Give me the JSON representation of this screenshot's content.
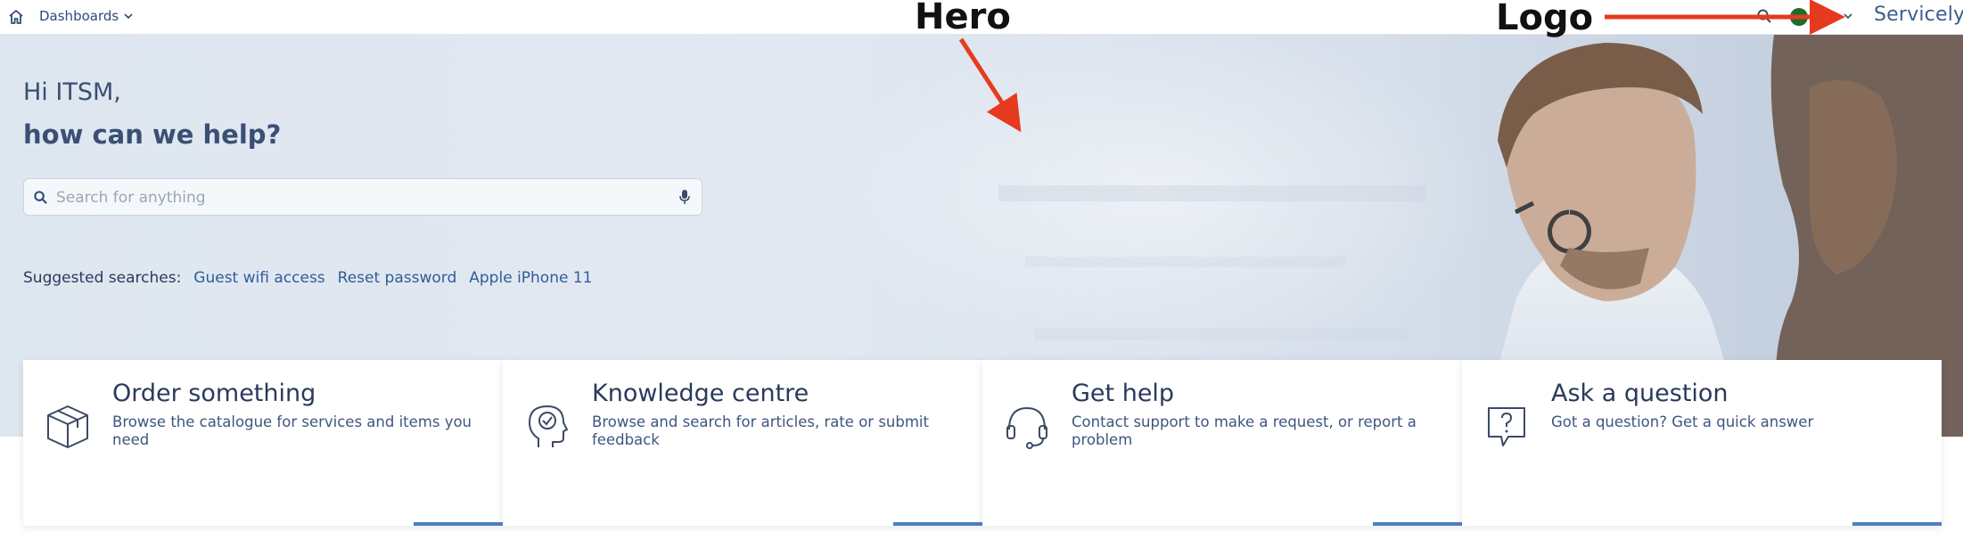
{
  "nav": {
    "dashboards_label": "Dashboards",
    "brand": "Servicely",
    "icons": [
      "home-icon",
      "chevron-down-icon",
      "search-icon",
      "user-avatar",
      "chevron-down-icon"
    ]
  },
  "hero": {
    "greeting": "Hi ITSM,",
    "heading": "how can we help?",
    "search_placeholder": "Search for anything",
    "suggested_label": "Suggested searches:",
    "suggested": [
      "Guest wifi access",
      "Reset password",
      "Apple iPhone 11"
    ]
  },
  "cards": [
    {
      "title": "Order something",
      "desc": "Browse the catalogue for services and items you need",
      "icon": "box-icon"
    },
    {
      "title": "Knowledge centre",
      "desc": "Browse and search for articles, rate or submit feedback",
      "icon": "head-check-icon"
    },
    {
      "title": "Get help",
      "desc": "Contact support to make a request, or report a problem",
      "icon": "headset-icon"
    },
    {
      "title": "Ask a question",
      "desc": "Got a question? Get a quick answer",
      "icon": "question-bubble-icon"
    }
  ],
  "annotations": {
    "hero_label": "Hero",
    "logo_label": "Logo",
    "arrow_color": "#e63a1e"
  },
  "colors": {
    "accent": "#4a7fc0",
    "link": "#2f5d99",
    "text": "#2a3a5c"
  }
}
